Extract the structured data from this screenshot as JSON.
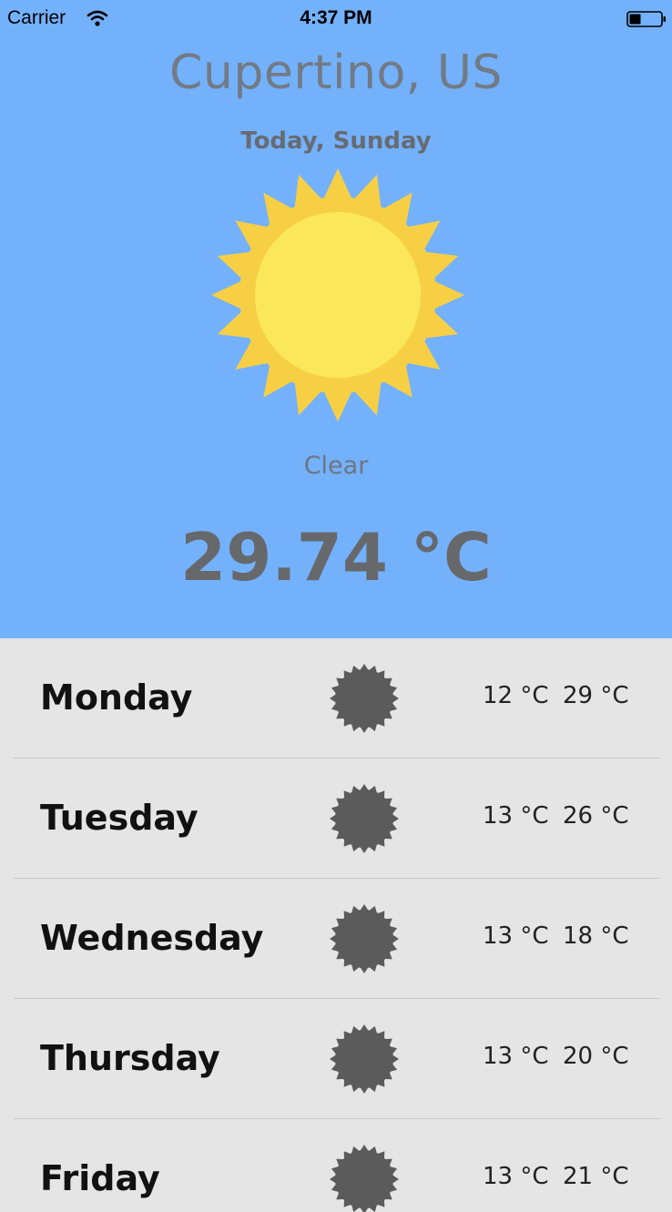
{
  "status_bar": {
    "carrier": "Carrier",
    "time": "4:37 PM",
    "icons": [
      "wifi-icon",
      "battery-icon"
    ]
  },
  "current": {
    "city": "Cupertino, US",
    "day": "Today, Sunday",
    "icon": "sun-icon",
    "condition": "Clear",
    "temperature": "29.74 °C"
  },
  "forecast": [
    {
      "day": "Monday",
      "icon": "sun-icon",
      "low": "12 °C",
      "high": "29 °C"
    },
    {
      "day": "Tuesday",
      "icon": "sun-icon",
      "low": "13 °C",
      "high": "26 °C"
    },
    {
      "day": "Wednesday",
      "icon": "sun-icon",
      "low": "13 °C",
      "high": "18 °C"
    },
    {
      "day": "Thursday",
      "icon": "sun-icon",
      "low": "13 °C",
      "high": "20 °C"
    },
    {
      "day": "Friday",
      "icon": "sun-icon",
      "low": "13 °C",
      "high": "21 °C"
    }
  ],
  "colors": {
    "hero_background": "#74b1fb",
    "list_background": "#e5e5e5",
    "sun_outer": "#f7cf45",
    "sun_inner": "#fbe85a",
    "forecast_icon": "#5b5b5b"
  }
}
